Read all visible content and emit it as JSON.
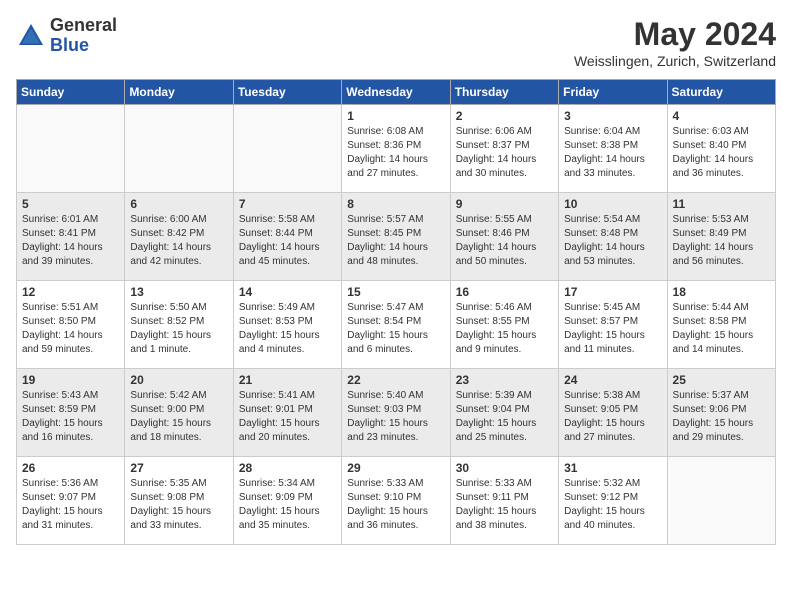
{
  "header": {
    "logo_general": "General",
    "logo_blue": "Blue",
    "month_year": "May 2024",
    "location": "Weisslingen, Zurich, Switzerland"
  },
  "days_of_week": [
    "Sunday",
    "Monday",
    "Tuesday",
    "Wednesday",
    "Thursday",
    "Friday",
    "Saturday"
  ],
  "weeks": [
    [
      {
        "day": "",
        "empty": true
      },
      {
        "day": "",
        "empty": true
      },
      {
        "day": "",
        "empty": true
      },
      {
        "day": "1",
        "sunrise": "6:08 AM",
        "sunset": "8:36 PM",
        "daylight": "14 hours and 27 minutes."
      },
      {
        "day": "2",
        "sunrise": "6:06 AM",
        "sunset": "8:37 PM",
        "daylight": "14 hours and 30 minutes."
      },
      {
        "day": "3",
        "sunrise": "6:04 AM",
        "sunset": "8:38 PM",
        "daylight": "14 hours and 33 minutes."
      },
      {
        "day": "4",
        "sunrise": "6:03 AM",
        "sunset": "8:40 PM",
        "daylight": "14 hours and 36 minutes."
      }
    ],
    [
      {
        "day": "5",
        "sunrise": "6:01 AM",
        "sunset": "8:41 PM",
        "daylight": "14 hours and 39 minutes."
      },
      {
        "day": "6",
        "sunrise": "6:00 AM",
        "sunset": "8:42 PM",
        "daylight": "14 hours and 42 minutes."
      },
      {
        "day": "7",
        "sunrise": "5:58 AM",
        "sunset": "8:44 PM",
        "daylight": "14 hours and 45 minutes."
      },
      {
        "day": "8",
        "sunrise": "5:57 AM",
        "sunset": "8:45 PM",
        "daylight": "14 hours and 48 minutes."
      },
      {
        "day": "9",
        "sunrise": "5:55 AM",
        "sunset": "8:46 PM",
        "daylight": "14 hours and 50 minutes."
      },
      {
        "day": "10",
        "sunrise": "5:54 AM",
        "sunset": "8:48 PM",
        "daylight": "14 hours and 53 minutes."
      },
      {
        "day": "11",
        "sunrise": "5:53 AM",
        "sunset": "8:49 PM",
        "daylight": "14 hours and 56 minutes."
      }
    ],
    [
      {
        "day": "12",
        "sunrise": "5:51 AM",
        "sunset": "8:50 PM",
        "daylight": "14 hours and 59 minutes."
      },
      {
        "day": "13",
        "sunrise": "5:50 AM",
        "sunset": "8:52 PM",
        "daylight": "15 hours and 1 minute."
      },
      {
        "day": "14",
        "sunrise": "5:49 AM",
        "sunset": "8:53 PM",
        "daylight": "15 hours and 4 minutes."
      },
      {
        "day": "15",
        "sunrise": "5:47 AM",
        "sunset": "8:54 PM",
        "daylight": "15 hours and 6 minutes."
      },
      {
        "day": "16",
        "sunrise": "5:46 AM",
        "sunset": "8:55 PM",
        "daylight": "15 hours and 9 minutes."
      },
      {
        "day": "17",
        "sunrise": "5:45 AM",
        "sunset": "8:57 PM",
        "daylight": "15 hours and 11 minutes."
      },
      {
        "day": "18",
        "sunrise": "5:44 AM",
        "sunset": "8:58 PM",
        "daylight": "15 hours and 14 minutes."
      }
    ],
    [
      {
        "day": "19",
        "sunrise": "5:43 AM",
        "sunset": "8:59 PM",
        "daylight": "15 hours and 16 minutes."
      },
      {
        "day": "20",
        "sunrise": "5:42 AM",
        "sunset": "9:00 PM",
        "daylight": "15 hours and 18 minutes."
      },
      {
        "day": "21",
        "sunrise": "5:41 AM",
        "sunset": "9:01 PM",
        "daylight": "15 hours and 20 minutes."
      },
      {
        "day": "22",
        "sunrise": "5:40 AM",
        "sunset": "9:03 PM",
        "daylight": "15 hours and 23 minutes."
      },
      {
        "day": "23",
        "sunrise": "5:39 AM",
        "sunset": "9:04 PM",
        "daylight": "15 hours and 25 minutes."
      },
      {
        "day": "24",
        "sunrise": "5:38 AM",
        "sunset": "9:05 PM",
        "daylight": "15 hours and 27 minutes."
      },
      {
        "day": "25",
        "sunrise": "5:37 AM",
        "sunset": "9:06 PM",
        "daylight": "15 hours and 29 minutes."
      }
    ],
    [
      {
        "day": "26",
        "sunrise": "5:36 AM",
        "sunset": "9:07 PM",
        "daylight": "15 hours and 31 minutes."
      },
      {
        "day": "27",
        "sunrise": "5:35 AM",
        "sunset": "9:08 PM",
        "daylight": "15 hours and 33 minutes."
      },
      {
        "day": "28",
        "sunrise": "5:34 AM",
        "sunset": "9:09 PM",
        "daylight": "15 hours and 35 minutes."
      },
      {
        "day": "29",
        "sunrise": "5:33 AM",
        "sunset": "9:10 PM",
        "daylight": "15 hours and 36 minutes."
      },
      {
        "day": "30",
        "sunrise": "5:33 AM",
        "sunset": "9:11 PM",
        "daylight": "15 hours and 38 minutes."
      },
      {
        "day": "31",
        "sunrise": "5:32 AM",
        "sunset": "9:12 PM",
        "daylight": "15 hours and 40 minutes."
      },
      {
        "day": "",
        "empty": true
      }
    ]
  ]
}
